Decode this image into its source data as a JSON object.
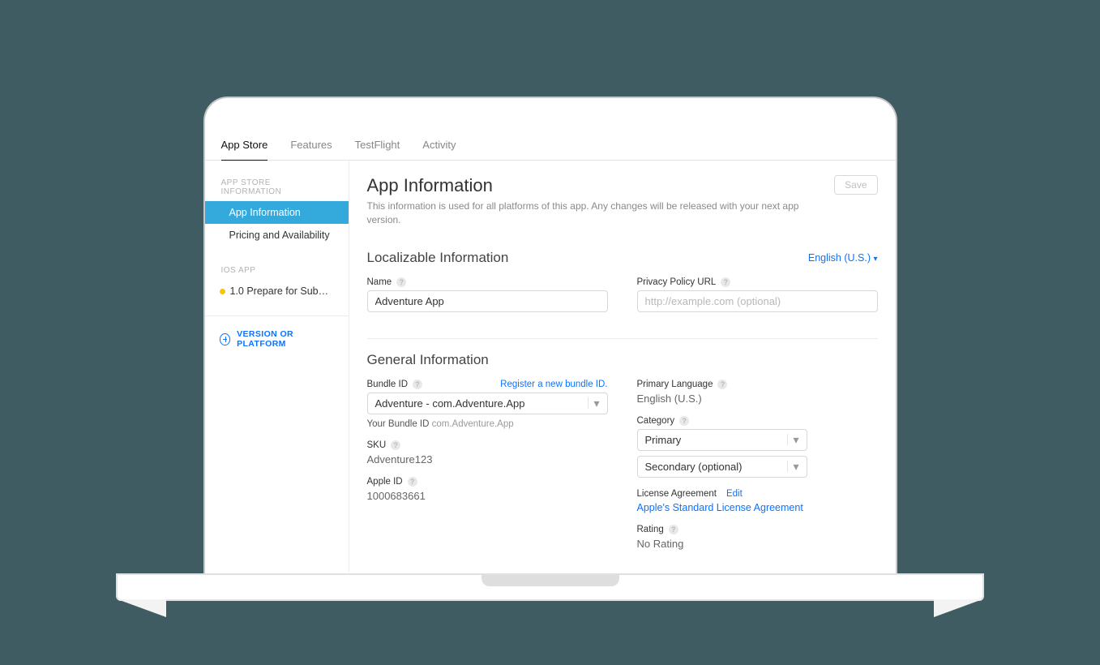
{
  "tabs": [
    "App Store",
    "Features",
    "TestFlight",
    "Activity"
  ],
  "active_tab": "App Store",
  "sidebar": {
    "sections": [
      {
        "label": "APP STORE INFORMATION",
        "items": [
          "App Information",
          "Pricing and Availability"
        ],
        "active": "App Information"
      },
      {
        "label": "IOS APP",
        "items": [
          "1.0 Prepare for Submiss…"
        ],
        "status_dot": true
      }
    ],
    "version_button": "VERSION OR PLATFORM"
  },
  "page": {
    "title": "App Information",
    "description": "This information is used for all platforms of this app. Any changes will be released with your next app version.",
    "save_button": "Save"
  },
  "localizable": {
    "heading": "Localizable Information",
    "language_picker": "English (U.S.)",
    "name_label": "Name",
    "name_value": "Adventure App",
    "privacy_label": "Privacy Policy URL",
    "privacy_placeholder": "http://example.com (optional)",
    "privacy_value": ""
  },
  "general": {
    "heading": "General Information",
    "bundle_id_label": "Bundle ID",
    "register_link": "Register a new bundle ID.",
    "bundle_id_select": "Adventure - com.Adventure.App",
    "your_bundle_id_label": "Your Bundle ID",
    "your_bundle_id_value": "com.Adventure.App",
    "sku_label": "SKU",
    "sku_value": "Adventure123",
    "apple_id_label": "Apple ID",
    "apple_id_value": "1000683661",
    "primary_language_label": "Primary Language",
    "primary_language_value": "English (U.S.)",
    "category_label": "Category",
    "category_primary": "Primary",
    "category_secondary": "Secondary (optional)",
    "license_label": "License Agreement",
    "license_edit": "Edit",
    "license_link": "Apple's Standard License Agreement",
    "rating_label": "Rating",
    "rating_value": "No Rating"
  }
}
